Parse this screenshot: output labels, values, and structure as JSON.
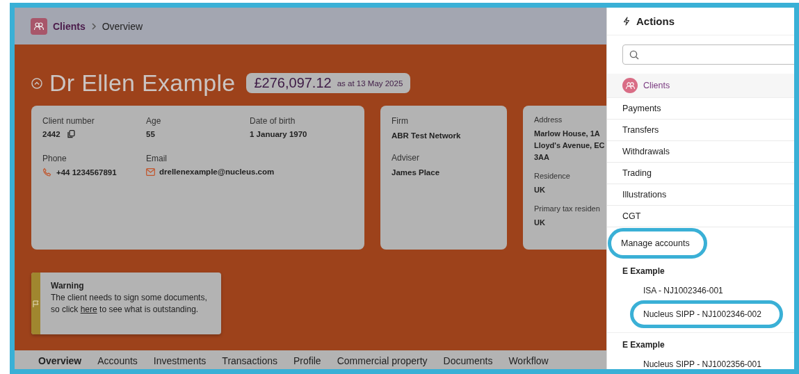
{
  "breadcrumb": [
    {
      "label": "Clients",
      "kind": "link"
    },
    {
      "label": "Overview",
      "kind": "current"
    }
  ],
  "client": {
    "name": "Dr Ellen Example",
    "balance": "£276,097.12",
    "balance_date": "as at 13 May 2025"
  },
  "details_card": {
    "fields": [
      {
        "label": "Client number",
        "value": "2442",
        "kind": "copy"
      },
      {
        "label": "Age",
        "value": "55",
        "kind": "plain"
      },
      {
        "label": "Date of birth",
        "value": "1 January 1970",
        "kind": "plain"
      },
      {
        "label": "Phone",
        "value": "+44 1234567891",
        "kind": "phone"
      },
      {
        "label": "Email",
        "value": "drellenexample@nucleus.com",
        "kind": "email"
      }
    ]
  },
  "firm_card": {
    "fields": [
      {
        "label": "Firm",
        "lines": [
          "ABR Test Network"
        ]
      },
      {
        "label": "Adviser",
        "lines": [
          "James Place"
        ]
      }
    ]
  },
  "address_card": {
    "fields": [
      {
        "label": "Address",
        "lines": [
          "Marlow House, 1A",
          "Lloyd's Avenue, EC",
          "3AA"
        ]
      },
      {
        "label": "Residence",
        "lines": [
          "UK"
        ]
      },
      {
        "label": "Primary tax residen",
        "lines": [
          "UK"
        ]
      }
    ]
  },
  "warning": {
    "title": "Warning",
    "text_before": "The client needs to sign some documents, so click ",
    "link": "here",
    "text_after": " to see what is outstanding."
  },
  "tabs": [
    {
      "label": "Overview",
      "selected": true
    },
    {
      "label": "Accounts",
      "selected": false
    },
    {
      "label": "Investments",
      "selected": false
    },
    {
      "label": "Transactions",
      "selected": false
    },
    {
      "label": "Profile",
      "selected": false
    },
    {
      "label": "Commercial property",
      "selected": false
    },
    {
      "label": "Documents",
      "selected": false
    },
    {
      "label": "Workflow",
      "selected": false
    }
  ],
  "actions_panel": {
    "title": "Actions",
    "items": [
      {
        "label": "Clients",
        "kind": "section",
        "highlighted": false
      },
      {
        "label": "Payments",
        "kind": "action",
        "highlighted": false
      },
      {
        "label": "Transfers",
        "kind": "action",
        "highlighted": false
      },
      {
        "label": "Withdrawals",
        "kind": "action",
        "highlighted": false
      },
      {
        "label": "Trading",
        "kind": "action",
        "highlighted": false
      },
      {
        "label": "Illustrations",
        "kind": "action",
        "highlighted": false
      },
      {
        "label": "CGT",
        "kind": "action",
        "highlighted": false
      },
      {
        "label": "Manage accounts",
        "kind": "action",
        "highlighted": true
      },
      {
        "label": "E Example",
        "kind": "group",
        "highlighted": false,
        "children": [
          {
            "label": "ISA - NJ1002346-001",
            "highlighted": false
          },
          {
            "label": "Nucleus SIPP - NJ1002346-002",
            "highlighted": true
          }
        ]
      },
      {
        "label": "E Example",
        "kind": "group",
        "highlighted": false,
        "children": [
          {
            "label": "Nucleus SIPP - NJ1002356-001",
            "highlighted": false
          }
        ]
      }
    ]
  }
}
